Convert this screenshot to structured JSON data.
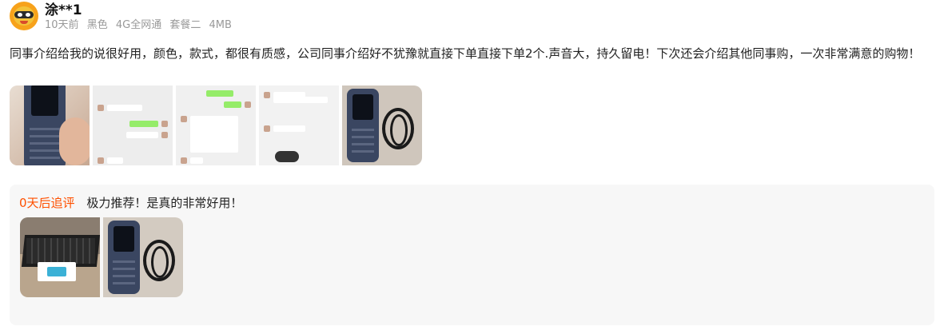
{
  "user": {
    "name": "涂**1",
    "time": "10天前",
    "specs": [
      "黑色",
      "4G全网通",
      "套餐二",
      "4MB"
    ]
  },
  "review": {
    "text": "同事介绍给我的说很好用，颜色，款式，都很有质感，公司同事介绍好不犹豫就直接下单直接下单2个.声音大，持久留电！下次还会介绍其他同事购，一次非常满意的购物！",
    "image_count": 5
  },
  "followup": {
    "tag": "0天后追评",
    "text": "极力推荐！是真的非常好用！",
    "image_count": 2
  },
  "colors": {
    "accent": "#ff5000",
    "followup_bg": "#f7f7f7",
    "meta_text": "#999999"
  }
}
